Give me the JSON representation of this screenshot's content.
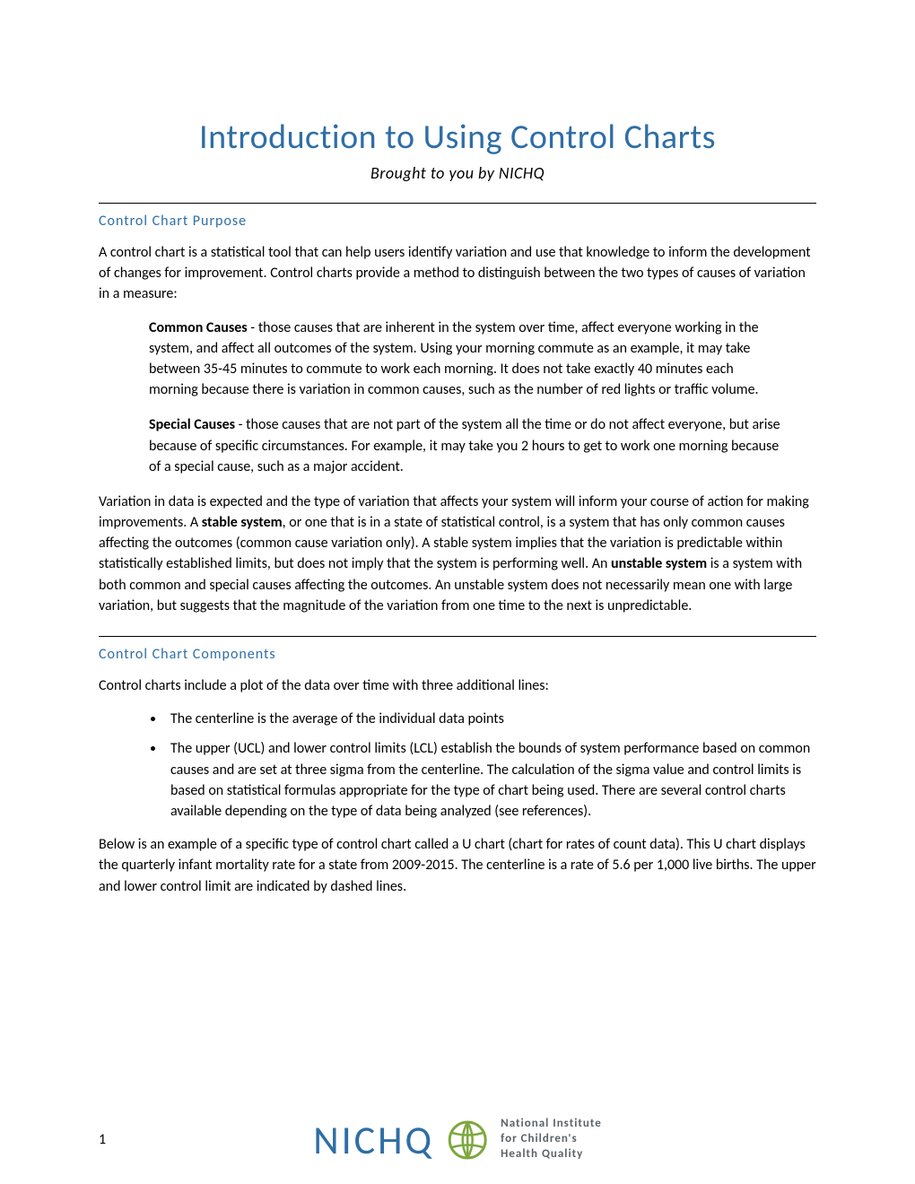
{
  "header": {
    "title": "Introduction to Using Control Charts",
    "subtitle": "Brought to you by NICHQ"
  },
  "section1": {
    "heading": "Control Chart Purpose",
    "intro": "A control chart is a statistical tool that can help users identify variation and use that knowledge to inform the development of changes for improvement. Control charts provide a method to distinguish between the two types of causes of variation in a measure:",
    "common_label": "Common Causes",
    "common_text": " - those causes that are inherent in the system over time, affect everyone working in the system, and affect all outcomes of the system. Using your morning commute as an example, it may take between 35-45 minutes to commute to work each morning. It does not take exactly 40 minutes each morning because there is variation in common causes, such as the number of red lights or traffic volume.",
    "special_label": "Special Causes",
    "special_text": " - those causes that are not part of the system all the time or do not affect everyone, but arise because of specific circumstances. For example, it may take you 2 hours to get to work one morning because of a special cause, such as a major accident.",
    "variation_p1a": "Variation in data is expected and the type of variation that affects your system will inform your course of action for making improvements. A ",
    "stable_label": "stable system",
    "variation_p1b": ", or one that is in a state of statistical control, is a system that has only common causes affecting the outcomes (common cause variation only). A stable system implies that the variation is predictable within statistically established limits, but does not imply that the system is performing well.  An ",
    "unstable_label": "unstable system",
    "variation_p1c": " is a system with both common and special causes affecting the outcomes. An unstable system does not necessarily mean one with large variation, but suggests that the magnitude of the variation from one time to the next is unpredictable."
  },
  "section2": {
    "heading": "Control Chart Components",
    "intro": "Control charts include a plot of the data over time with three additional lines:",
    "bullets": [
      "The centerline is the average of the individual data points",
      "The upper (UCL) and lower control limits (LCL) establish the bounds of system performance based on common causes and are set at three sigma from the centerline. The calculation of the sigma value and control limits is based on statistical formulas appropriate for the type of chart being used.  There are several control charts available depending on the type of data being analyzed (see references)."
    ],
    "below_text": "Below is an example of a specific type of control chart called a U chart (chart for rates of count data). This U chart displays the quarterly infant mortality rate for a state from 2009-2015. The centerline is a rate of 5.6 per 1,000 live births. The upper and lower control limit are indicated by dashed lines."
  },
  "footer": {
    "page_num": "1",
    "logo_text": "NICHQ",
    "logo_caption_l1": "National Institute",
    "logo_caption_l2": "for Children's",
    "logo_caption_l3": "Health Quality"
  }
}
